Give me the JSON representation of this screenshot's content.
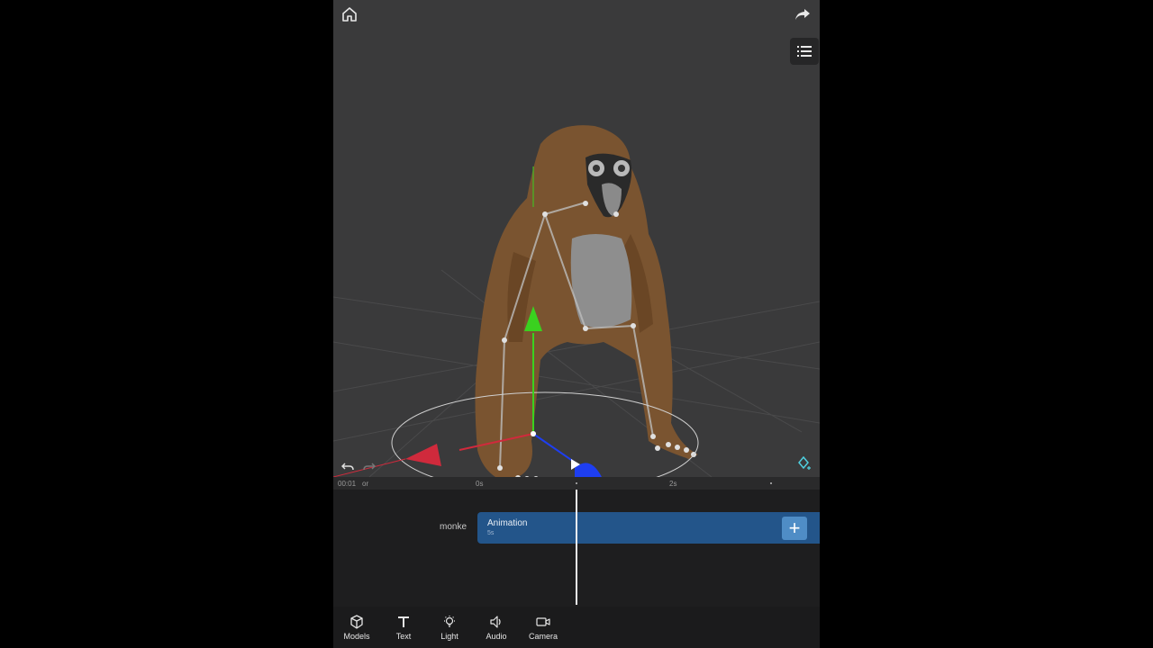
{
  "viewport": {
    "home_icon": "home-icon",
    "share_icon": "share-arrow-icon",
    "menu_icon": "list-menu-icon",
    "undo_icon": "undo-icon",
    "redo_icon": "redo-icon",
    "keyframe_icon": "add-keyframe-icon",
    "play_icon": "play-icon",
    "model_name": "monke"
  },
  "ruler": {
    "time": "00:01",
    "time_suffix": "or",
    "marks": [
      "0s",
      "2s"
    ]
  },
  "timeline": {
    "track_label": "monke",
    "clip_title": "Animation",
    "clip_duration": "5s",
    "add_label": "+"
  },
  "toolbar": {
    "items": [
      {
        "label": "Models",
        "icon": "cube-icon"
      },
      {
        "label": "Text",
        "icon": "text-icon"
      },
      {
        "label": "Light",
        "icon": "lightbulb-icon"
      },
      {
        "label": "Audio",
        "icon": "speaker-icon"
      },
      {
        "label": "Camera",
        "icon": "camera-icon"
      }
    ]
  },
  "colors": {
    "clip": "#23558a",
    "add_button": "#4f8dc6",
    "axis_x": "#d02a3c",
    "axis_y": "#3ad11f",
    "axis_z": "#1e3ef0"
  }
}
